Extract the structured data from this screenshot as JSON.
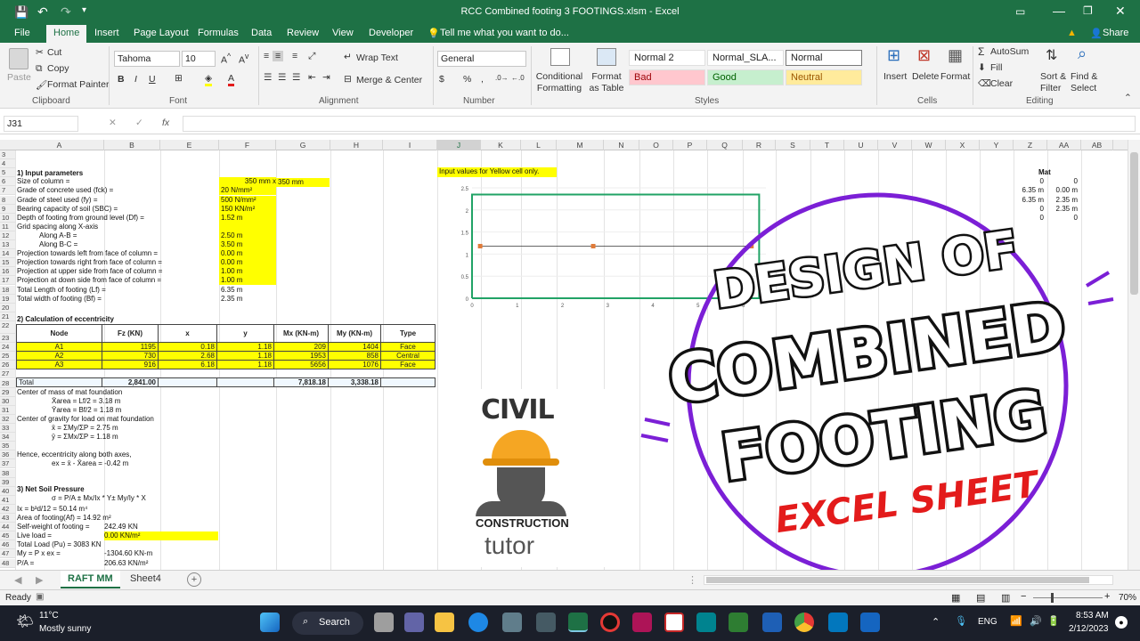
{
  "window": {
    "title": "RCC Combined footing 3 FOOTINGS.xlsm - Excel",
    "search": "Tell me what you want to do...",
    "share": "Share"
  },
  "tabs": [
    "File",
    "Home",
    "Insert",
    "Page Layout",
    "Formulas",
    "Data",
    "Review",
    "View",
    "Developer"
  ],
  "ribbon": {
    "clipboard": {
      "paste": "Paste",
      "cut": "Cut",
      "copy": "Copy",
      "painter": "Format Painter",
      "label": "Clipboard"
    },
    "font": {
      "name": "Tahoma",
      "size": "10",
      "label": "Font"
    },
    "alignment": {
      "wrap": "Wrap Text",
      "merge": "Merge & Center",
      "label": "Alignment"
    },
    "number": {
      "format": "General",
      "label": "Number"
    },
    "styles": {
      "conditional": "Conditional Formatting",
      "format_table": "Format as Table",
      "normal2": "Normal 2",
      "normal_sla": "Normal_SLA...",
      "normal": "Normal",
      "bad": "Bad",
      "good": "Good",
      "neutral": "Neutral",
      "label": "Styles"
    },
    "cells": {
      "insert": "Insert",
      "delete": "Delete",
      "format": "Format",
      "label": "Cells"
    },
    "editing": {
      "autosum": "AutoSum",
      "fill": "Fill",
      "clear": "Clear",
      "sort": "Sort & Filter",
      "find": "Find & Select",
      "label": "Editing"
    }
  },
  "formula_bar": {
    "name_box": "J31",
    "fx": "fx"
  },
  "columns": [
    "A",
    "B",
    "E",
    "F",
    "G",
    "H",
    "I",
    "J",
    "K",
    "L",
    "M",
    "N",
    "O",
    "P",
    "Q",
    "R",
    "S",
    "T",
    "U",
    "V",
    "W",
    "X",
    "Y",
    "Z",
    "AA",
    "AB"
  ],
  "rows": [
    "3",
    "4",
    "5",
    "6",
    "7",
    "8",
    "9",
    "10",
    "11",
    "12",
    "13",
    "14",
    "15",
    "16",
    "17",
    "18",
    "19",
    "20",
    "21",
    "22",
    "23",
    "24",
    "25",
    "26",
    "27",
    "28",
    "29",
    "30",
    "31",
    "32",
    "33",
    "34",
    "35",
    "36",
    "37",
    "38",
    "39",
    "40",
    "41",
    "42",
    "43",
    "44",
    "45",
    "46",
    "47",
    "48"
  ],
  "input": {
    "heading": "1) Input parameters",
    "items": [
      {
        "label": "Size of column =",
        "value": "350 mm x",
        "value2": "350 mm"
      },
      {
        "label": "Grade of concrete used (fck) =",
        "value": "20 N/mm²"
      },
      {
        "label": "Grade of steel used (fy) =",
        "value": "500 N/mm²"
      },
      {
        "label": "Bearing capacity of soil (SBC) =",
        "value": "150 KN/m²"
      },
      {
        "label": "Depth of footing from ground level (Df) =",
        "value": "1.52 m"
      },
      {
        "label": "Grid spacing along X-axis",
        "value": ""
      },
      {
        "label": "Along A-B =",
        "value": "2.50 m"
      },
      {
        "label": "Along B-C =",
        "value": "3.50 m"
      },
      {
        "label": "Projection towards left from face of column =",
        "value": "0.00 m"
      },
      {
        "label": "Projection towards right from face of column =",
        "value": "0.00 m"
      },
      {
        "label": "Projection at upper side from face of column =",
        "value": "1.00 m"
      },
      {
        "label": "Projection at down side from face of column =",
        "value": "1.00 m"
      },
      {
        "label": "Total Length of footing (Lf) =",
        "value": "6.35 m"
      },
      {
        "label": "Total width of footing (Bf) =",
        "value": "2.35 m"
      }
    ],
    "note": "Input values for Yellow cell only."
  },
  "eccentricity": {
    "heading": "2) Calculation of eccentricity",
    "headers": [
      "Node",
      "Fz (KN)",
      "x",
      "y",
      "Mx (KN-m)",
      "My (KN-m)",
      "Type"
    ],
    "rows": [
      [
        "A1",
        "1195",
        "0.18",
        "1.18",
        "209",
        "1404",
        "Face"
      ],
      [
        "A2",
        "730",
        "2.68",
        "1.18",
        "1953",
        "858",
        "Central"
      ],
      [
        "A3",
        "916",
        "6.18",
        "1.18",
        "5656",
        "1076",
        "Face"
      ]
    ],
    "total": [
      "Total",
      "2,841.00",
      "",
      "",
      "7,818.18",
      "3,338.18",
      ""
    ]
  },
  "centers": [
    "Center of mass of mat foundation",
    "X̄area = Lf/2 = 3.18 m",
    "Ȳarea = Bf/2 = 1.18 m",
    "Center of gravity for load on mat foundation",
    "x̄ = ΣMy/ΣP = 2.75 m",
    "ȳ = ΣMx/ΣP = 1.18 m",
    "Hence, eccentricity along both axes,",
    "ex = x̄ - X̄area = -0.42 m"
  ],
  "soil": {
    "heading": "3) Net Soil Pressure",
    "formula": "σ = P/A ± Mx/Ix * Y± My/Iy * X",
    "lines": [
      {
        "label": "Ix = b³d/12 = 50.14 m⁴",
        "value": ""
      },
      {
        "label": "Area of footing(Af) = 14.92  m²",
        "value": ""
      },
      {
        "label": "Self-weight of footing =",
        "value": "242.49 KN"
      },
      {
        "label": "Live load =",
        "value": "0.00 KN/m²"
      },
      {
        "label": "Total Load (Pu) = 3083 KN",
        "value": ""
      },
      {
        "label": "My = P x ex =",
        "value": "-1304.60 KN-m"
      },
      {
        "label": "P/A =",
        "value": "206.63 KN/m²"
      }
    ]
  },
  "mat": {
    "title": "Mat",
    "rows": [
      [
        "0",
        "0"
      ],
      [
        "6.35 m",
        "0.00 m"
      ],
      [
        "6.35 m",
        "2.35 m"
      ],
      [
        "0",
        "2.35 m"
      ],
      [
        "0",
        "0"
      ]
    ]
  },
  "chart_data": {
    "type": "scatter",
    "x_ticks": [
      "0",
      "1",
      "2",
      "3",
      "4",
      "5",
      "6"
    ],
    "y_ticks": [
      "0",
      "0.5",
      "1",
      "1.5",
      "2",
      "2.5"
    ],
    "xlim": [
      0,
      6.5
    ],
    "ylim": [
      0,
      2.5
    ],
    "series": [
      {
        "x": [
          0.18,
          2.68,
          6.18
        ],
        "y": [
          1.18,
          1.18,
          1.18
        ],
        "color": "#e07b39"
      },
      {
        "x": [
          0,
          6.35,
          6.35,
          0,
          0
        ],
        "y": [
          0,
          0,
          2.35,
          2.35,
          0
        ],
        "color": "#21a366"
      }
    ]
  },
  "overlay": {
    "line1": "DESIGN OF",
    "line2": "COMBINED",
    "line3": "FOOTING",
    "line4": "EXCEL SHEET",
    "logo_top": "CIVIL",
    "logo_mid": "CONSTRUCTION",
    "logo_bottom": "tutor"
  },
  "sheet_tabs": [
    "RAFT MM",
    "Sheet4"
  ],
  "status": {
    "ready": "Ready",
    "zoom": "70%"
  },
  "taskbar": {
    "temp": "11°C",
    "weather": "Mostly sunny",
    "search": "Search",
    "lang": "ENG",
    "time": "8:53 AM",
    "date": "2/12/2023"
  },
  "colors": {
    "excel_green": "#1e7145",
    "yellow": "#ffff00",
    "purple": "#7b1fd6",
    "red": "#e31b1b"
  }
}
